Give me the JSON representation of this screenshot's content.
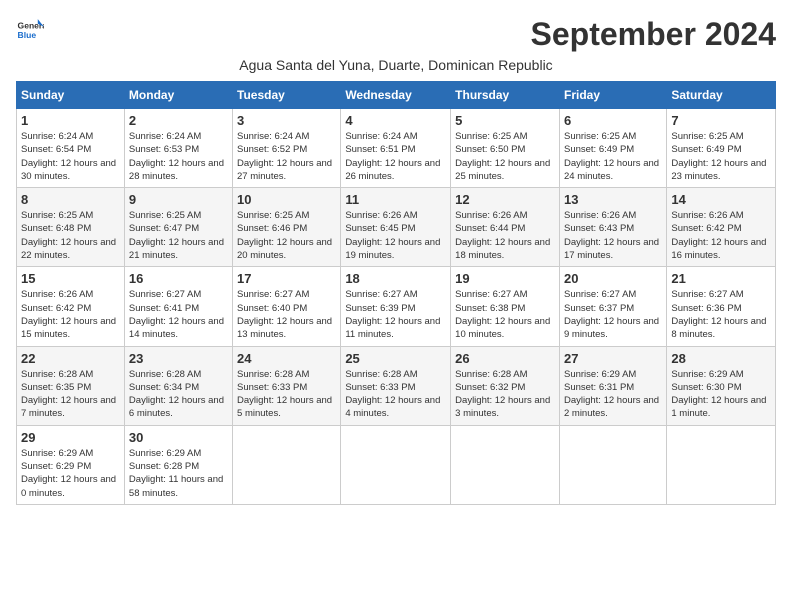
{
  "logo": {
    "line1": "General",
    "line2": "Blue"
  },
  "title": "September 2024",
  "subtitle": "Agua Santa del Yuna, Duarte, Dominican Republic",
  "days_header": [
    "Sunday",
    "Monday",
    "Tuesday",
    "Wednesday",
    "Thursday",
    "Friday",
    "Saturday"
  ],
  "weeks": [
    [
      {
        "num": "1",
        "rise": "6:24 AM",
        "set": "6:54 PM",
        "daylight": "12 hours and 30 minutes."
      },
      {
        "num": "2",
        "rise": "6:24 AM",
        "set": "6:53 PM",
        "daylight": "12 hours and 28 minutes."
      },
      {
        "num": "3",
        "rise": "6:24 AM",
        "set": "6:52 PM",
        "daylight": "12 hours and 27 minutes."
      },
      {
        "num": "4",
        "rise": "6:24 AM",
        "set": "6:51 PM",
        "daylight": "12 hours and 26 minutes."
      },
      {
        "num": "5",
        "rise": "6:25 AM",
        "set": "6:50 PM",
        "daylight": "12 hours and 25 minutes."
      },
      {
        "num": "6",
        "rise": "6:25 AM",
        "set": "6:49 PM",
        "daylight": "12 hours and 24 minutes."
      },
      {
        "num": "7",
        "rise": "6:25 AM",
        "set": "6:49 PM",
        "daylight": "12 hours and 23 minutes."
      }
    ],
    [
      {
        "num": "8",
        "rise": "6:25 AM",
        "set": "6:48 PM",
        "daylight": "12 hours and 22 minutes."
      },
      {
        "num": "9",
        "rise": "6:25 AM",
        "set": "6:47 PM",
        "daylight": "12 hours and 21 minutes."
      },
      {
        "num": "10",
        "rise": "6:25 AM",
        "set": "6:46 PM",
        "daylight": "12 hours and 20 minutes."
      },
      {
        "num": "11",
        "rise": "6:26 AM",
        "set": "6:45 PM",
        "daylight": "12 hours and 19 minutes."
      },
      {
        "num": "12",
        "rise": "6:26 AM",
        "set": "6:44 PM",
        "daylight": "12 hours and 18 minutes."
      },
      {
        "num": "13",
        "rise": "6:26 AM",
        "set": "6:43 PM",
        "daylight": "12 hours and 17 minutes."
      },
      {
        "num": "14",
        "rise": "6:26 AM",
        "set": "6:42 PM",
        "daylight": "12 hours and 16 minutes."
      }
    ],
    [
      {
        "num": "15",
        "rise": "6:26 AM",
        "set": "6:42 PM",
        "daylight": "12 hours and 15 minutes."
      },
      {
        "num": "16",
        "rise": "6:27 AM",
        "set": "6:41 PM",
        "daylight": "12 hours and 14 minutes."
      },
      {
        "num": "17",
        "rise": "6:27 AM",
        "set": "6:40 PM",
        "daylight": "12 hours and 13 minutes."
      },
      {
        "num": "18",
        "rise": "6:27 AM",
        "set": "6:39 PM",
        "daylight": "12 hours and 11 minutes."
      },
      {
        "num": "19",
        "rise": "6:27 AM",
        "set": "6:38 PM",
        "daylight": "12 hours and 10 minutes."
      },
      {
        "num": "20",
        "rise": "6:27 AM",
        "set": "6:37 PM",
        "daylight": "12 hours and 9 minutes."
      },
      {
        "num": "21",
        "rise": "6:27 AM",
        "set": "6:36 PM",
        "daylight": "12 hours and 8 minutes."
      }
    ],
    [
      {
        "num": "22",
        "rise": "6:28 AM",
        "set": "6:35 PM",
        "daylight": "12 hours and 7 minutes."
      },
      {
        "num": "23",
        "rise": "6:28 AM",
        "set": "6:34 PM",
        "daylight": "12 hours and 6 minutes."
      },
      {
        "num": "24",
        "rise": "6:28 AM",
        "set": "6:33 PM",
        "daylight": "12 hours and 5 minutes."
      },
      {
        "num": "25",
        "rise": "6:28 AM",
        "set": "6:33 PM",
        "daylight": "12 hours and 4 minutes."
      },
      {
        "num": "26",
        "rise": "6:28 AM",
        "set": "6:32 PM",
        "daylight": "12 hours and 3 minutes."
      },
      {
        "num": "27",
        "rise": "6:29 AM",
        "set": "6:31 PM",
        "daylight": "12 hours and 2 minutes."
      },
      {
        "num": "28",
        "rise": "6:29 AM",
        "set": "6:30 PM",
        "daylight": "12 hours and 1 minute."
      }
    ],
    [
      {
        "num": "29",
        "rise": "6:29 AM",
        "set": "6:29 PM",
        "daylight": "12 hours and 0 minutes."
      },
      {
        "num": "30",
        "rise": "6:29 AM",
        "set": "6:28 PM",
        "daylight": "11 hours and 58 minutes."
      },
      null,
      null,
      null,
      null,
      null
    ]
  ]
}
